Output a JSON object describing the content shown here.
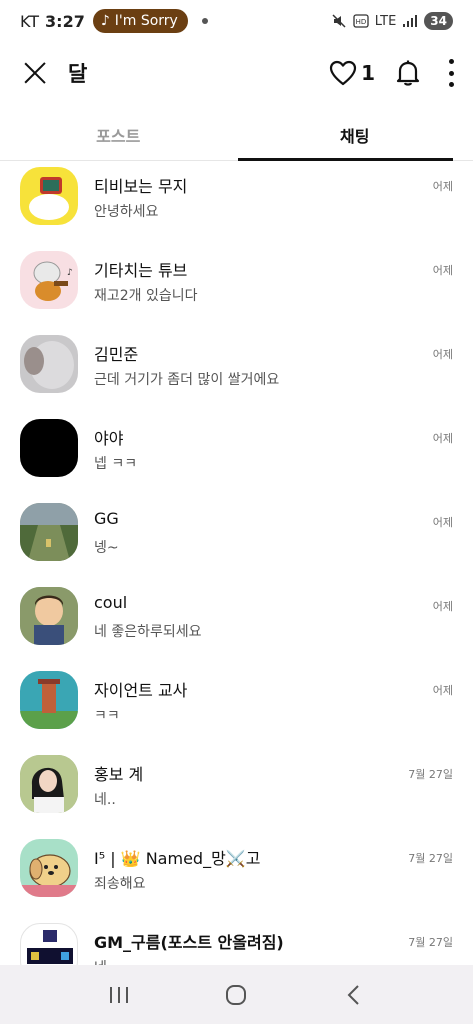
{
  "status_bar": {
    "carrier": "KT",
    "time": "3:27",
    "music_pill": "I'm Sorry",
    "network": "LTE",
    "battery": "34"
  },
  "header": {
    "title": "달",
    "like_count": "1"
  },
  "tabs": [
    {
      "label": "포스트",
      "active": false
    },
    {
      "label": "채팅",
      "active": true
    }
  ],
  "chats": [
    {
      "name": "티비보는 무지",
      "preview": "안녕하세요",
      "time": "어제",
      "avatar": "tv-muzi"
    },
    {
      "name": "기타치는 튜브",
      "preview": "재고2개 있습니다",
      "time": "어제",
      "avatar": "guitar-tube"
    },
    {
      "name": "김민준",
      "preview": "근데 거기가 좀더 많이 쌀거에요",
      "time": "어제",
      "avatar": "blurred-photo"
    },
    {
      "name": "야야",
      "preview": "넵 ㅋㅋ",
      "time": "어제",
      "avatar": "black"
    },
    {
      "name": "GG",
      "preview": "넹~",
      "time": "어제",
      "avatar": "game-field"
    },
    {
      "name": "coul",
      "preview": "네 좋은하루되세요",
      "time": "어제",
      "avatar": "cartoon-boy"
    },
    {
      "name": "자이언트 교사",
      "preview": "ㅋㅋ",
      "time": "어제",
      "avatar": "game-tower"
    },
    {
      "name": "홍보 계",
      "preview": "네..",
      "time": "7월 27일",
      "avatar": "girl-photo"
    },
    {
      "name": "I⁵ | 👑 Named_망⚔️고",
      "preview": "죄송해요",
      "time": "7월 27일",
      "avatar": "dog-cartoon"
    },
    {
      "name": "GM_구름(포스트 안올려짐)",
      "preview": "네",
      "time": "7월 27일",
      "avatar": "screenshot"
    }
  ],
  "colors": {
    "accent": "#111111",
    "pill": "#6b3f12",
    "nav_bg": "#f2f0f3"
  }
}
